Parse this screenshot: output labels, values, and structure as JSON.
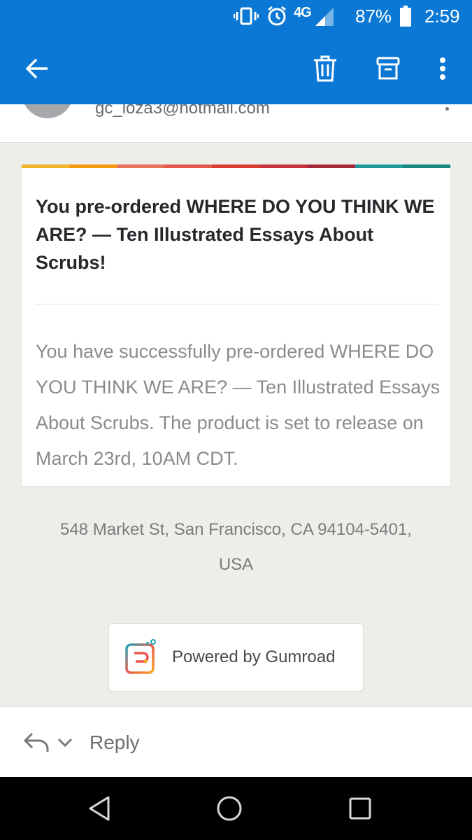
{
  "status_bar": {
    "network": "4G",
    "battery": "87%",
    "time": "2:59",
    "icons": [
      "vibrate-icon",
      "alarm-icon",
      "network-4g-lte-icon",
      "signal-icon",
      "battery-icon"
    ]
  },
  "app_bar": {
    "icons": [
      "back-arrow-icon",
      "trash-icon",
      "archive-icon",
      "more-vertical-icon"
    ],
    "color": "#0a78d4"
  },
  "sender": {
    "email": "gc_loza3@hotmail.com"
  },
  "email": {
    "stripe_colors": [
      "#f0b429",
      "#f39c12",
      "#e8735a",
      "#e2574c",
      "#d93d2e",
      "#c8313c",
      "#a8263a",
      "#1d9b9a",
      "#17877f"
    ],
    "title": "You pre-ordered WHERE DO YOU THINK WE ARE? — Ten Illustrated Essays About Scrubs!",
    "body": "You have successfully pre-ordered WHERE DO YOU THINK WE ARE? — Ten Illustrated Essays About Scrubs. The product is set to release on March 23rd, 10AM CDT.",
    "address_line1": "548 Market St, San Francisco, CA 94104-5401,",
    "address_line2": "USA",
    "powered_by": "Powered by Gumroad"
  },
  "reply_bar": {
    "label": "Reply",
    "icons": [
      "reply-icon",
      "chevron-down-icon"
    ]
  },
  "nav_bar": {
    "icons": [
      "back-triangle-icon",
      "home-circle-icon",
      "recents-square-icon"
    ]
  }
}
